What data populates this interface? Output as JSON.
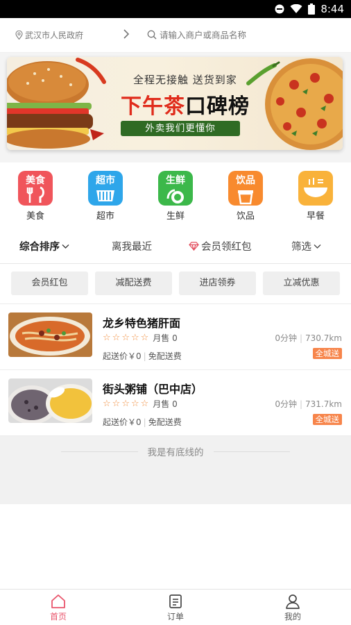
{
  "status_bar": {
    "time": "8:44"
  },
  "topbar": {
    "location": "武汉市人民政府",
    "search_placeholder": "请输入商户或商品名称"
  },
  "banner": {
    "line1": "全程无接触 送货到家",
    "headline_red": "下午茶",
    "headline_black": "口碑榜",
    "pill": "外卖我们更懂你"
  },
  "categories": [
    {
      "tile_text": "美食",
      "label": "美食",
      "color": "#f0555b"
    },
    {
      "tile_text": "超市",
      "label": "超市",
      "color": "#2ea6ea"
    },
    {
      "tile_text": "生鲜",
      "label": "生鲜",
      "color": "#3cb84a"
    },
    {
      "tile_text": "饮品",
      "label": "饮品",
      "color": "#f88a2e"
    },
    {
      "tile_text": "",
      "label": "早餐",
      "color": "#f9b23a"
    }
  ],
  "sort_bar": {
    "comprehensive": "综合排序",
    "nearest": "离我最近",
    "member_redpacket": "会员领红包",
    "filter": "筛选"
  },
  "chips": [
    "会员红包",
    "减配送费",
    "进店领券",
    "立减优惠"
  ],
  "stores": [
    {
      "name": "龙乡特色猪肝面",
      "monthly_sales": "月售 0",
      "min_order": "起送价￥0",
      "delivery_fee": "免配送费",
      "time": "0分钟",
      "distance": "730.7km",
      "badge": "全城送"
    },
    {
      "name": "街头粥铺（巴中店）",
      "monthly_sales": "月售 0",
      "min_order": "起送价￥0",
      "delivery_fee": "免配送费",
      "time": "0分钟",
      "distance": "731.7km",
      "badge": "全城送"
    }
  ],
  "end_text": "我是有底线的",
  "tabs": [
    {
      "label": "首页",
      "active": true
    },
    {
      "label": "订单",
      "active": false
    },
    {
      "label": "我的",
      "active": false
    }
  ],
  "colors": {
    "accent": "#e9546b",
    "badge": "#f7854b",
    "star": "#f08c3c"
  }
}
